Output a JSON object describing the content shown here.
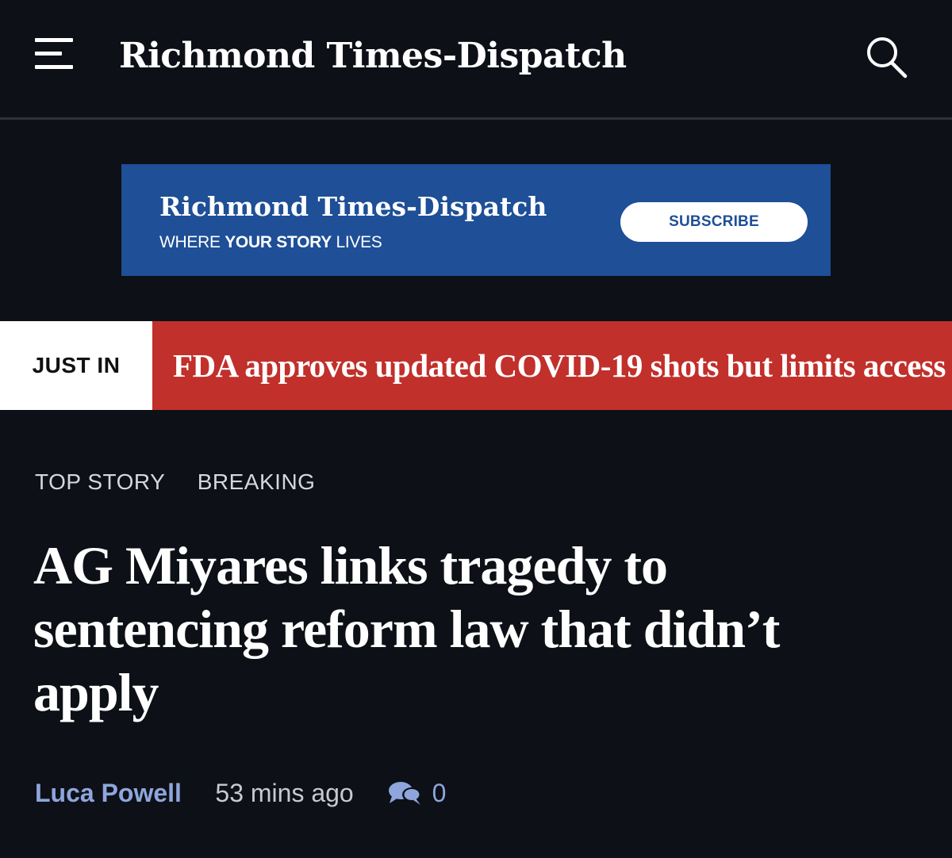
{
  "header": {
    "masthead": "Richmond Times-Dispatch",
    "menu_icon": "hamburger-menu-icon",
    "search_icon": "search-icon"
  },
  "ad": {
    "masthead": "Richmond Times-Dispatch",
    "tagline_prefix": "WHERE",
    "tagline_bold": "YOUR STORY",
    "tagline_suffix": "LIVES",
    "subscribe_label": "SUBSCRIBE",
    "background_color": "#1e4f97"
  },
  "just_in": {
    "label": "JUST IN",
    "headline": "FDA approves updated COVID-19 shots but limits access",
    "accent_color": "#c1302b"
  },
  "article": {
    "labels": [
      "TOP STORY",
      "BREAKING"
    ],
    "headline": "AG Miyares links tragedy to sentencing reform law that didn’t apply",
    "author": "Luca Powell",
    "timestamp": "53 mins ago",
    "comment_icon": "comments-icon",
    "comment_count": "0",
    "link_color": "#8ea6dc"
  }
}
